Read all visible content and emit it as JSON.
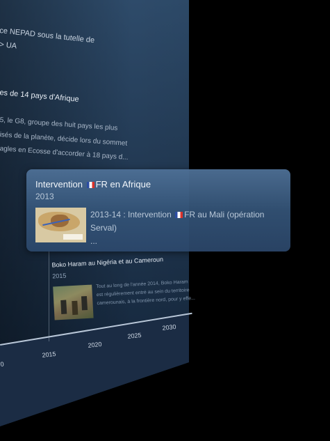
{
  "panel": {
    "lines": [
      "ce NEPAD sous la tutelle de",
      "> UA",
      "es de 14 pays d'Afrique",
      "5, le G8, groupe des huit pays les plus",
      "isés de la planète, décide lors du sommet",
      "agles en Ecosse d'accorder à 18 pays d..."
    ]
  },
  "boko_card": {
    "title": "Boko Haram au Nigéria et au Cameroun",
    "year": "2015",
    "desc_lines": [
      "Tout au long de l'année 2014, Boko Haram",
      "est régulièrement entré au sein du territoire",
      "camerounais, à la frontière nord, pour y effe..."
    ]
  },
  "axis": {
    "ticks": [
      "0",
      "2015",
      "2020",
      "2025",
      "2030"
    ]
  },
  "popup": {
    "title_before": "Intervention",
    "title_after": "FR en Afrique",
    "year": "2013",
    "entry_before": "2013-14 : Intervention",
    "entry_after": "FR au Mali (opération",
    "entry_line2": "Serval)",
    "entry_line3": "...",
    "flag_icon": "france-flag-icon"
  },
  "colors": {
    "panel": "#20364f",
    "popup": "#4a6d94",
    "axis": "#b9c7d8"
  }
}
